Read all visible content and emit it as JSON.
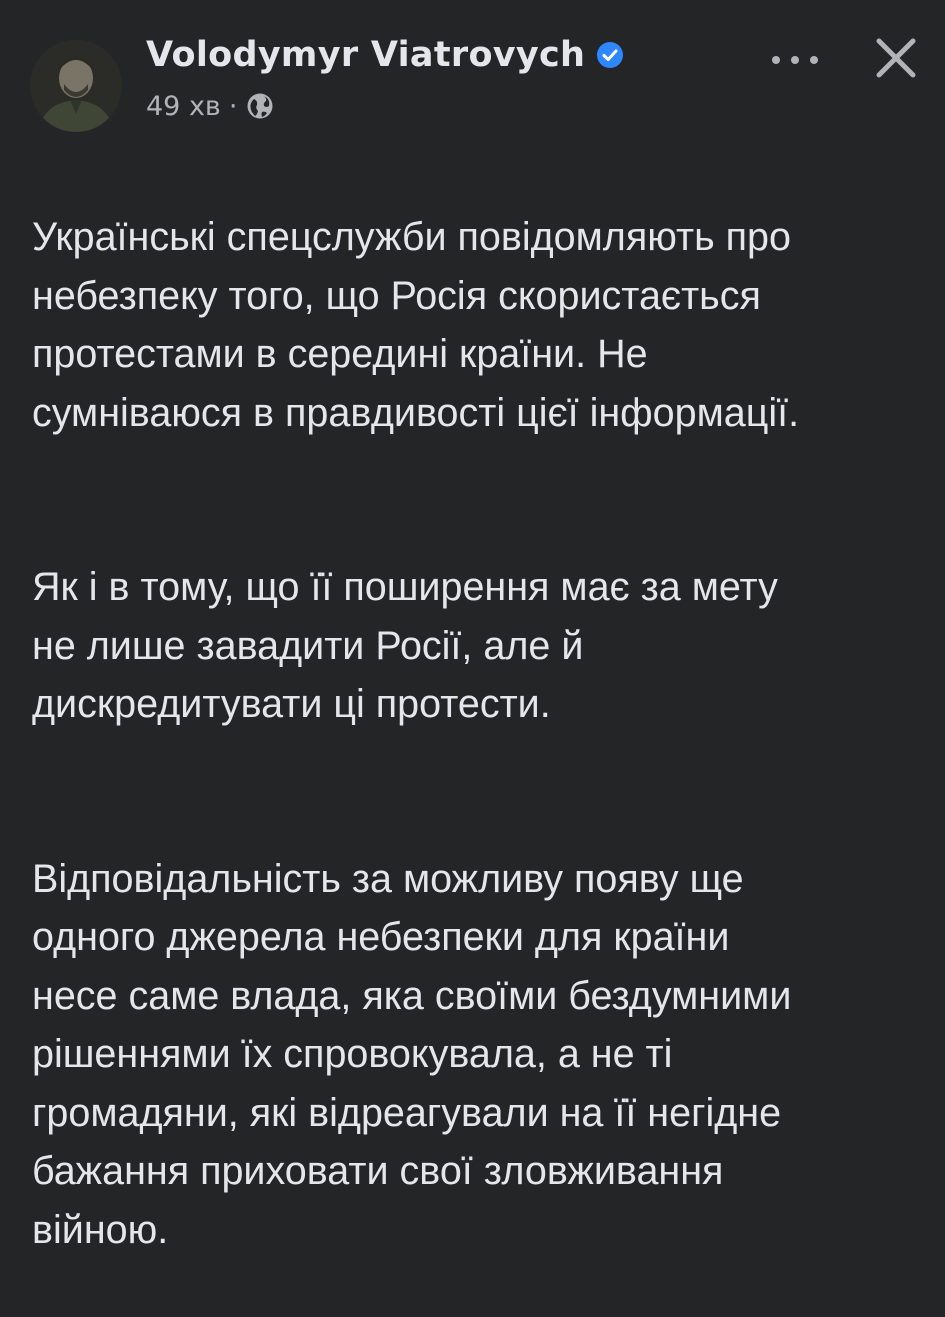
{
  "post": {
    "author": {
      "name": "Volodymyr Viatrovych",
      "verified": true
    },
    "meta": {
      "time": "49 хв",
      "separator": "·",
      "audience_icon": "globe-icon"
    },
    "actions": {
      "more_icon": "more-horizontal-icon",
      "close_icon": "close-icon"
    },
    "paragraphs": [
      "Українські спецслужби повідомляють про\nнебезпеку того, що Росія скористається\nпротестами в середині країни. Не\nсумніваюся в правдивості цієї інформації.",
      "Як і в тому, що її поширення має за мету\nне лише завадити Росії, але й\nдискредитувати ці протести.",
      "Відповідальність за можливу появу ще\nодного джерела небезпеки для країни\nнесе саме влада, яка своїми бездумними\nрішеннями їх спровокувала, а не ті\nгромадяни, які відреагували на її негідне\nбажання приховати свої зловживання\nвійною."
    ]
  },
  "colors": {
    "background": "#242526",
    "primary_text": "#e4e6eb",
    "secondary_text": "#b0b3b8",
    "verified_blue": "#2d88ff"
  }
}
